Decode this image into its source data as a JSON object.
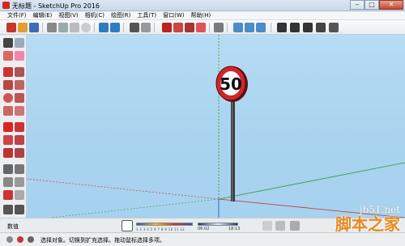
{
  "window": {
    "title": "无标题 - SketchUp Pro 2016",
    "minimize_icon": "minimize-icon",
    "maximize_icon": "maximize-icon",
    "close_icon": "close-icon"
  },
  "menu": [
    "文件(F)",
    "编辑(E)",
    "视图(V)",
    "相机(C)",
    "绘图(R)",
    "工具(T)",
    "窗口(W)",
    "帮助(H)"
  ],
  "toolbar": {
    "icons": [
      "new-icon",
      "open-icon",
      "save-icon",
      "cut-icon",
      "copy-icon",
      "paste-icon",
      "erase-icon",
      "undo-icon",
      "redo-icon",
      "print-icon",
      "model-info-icon",
      "component-icon",
      "group-icon",
      "upload-icon",
      "download-icon",
      "share-icon",
      "views-iso-icon",
      "views-top-icon",
      "views-front-icon",
      "views-right-icon",
      "views-back-icon",
      "views-left-icon"
    ]
  },
  "left_tools": [
    "select-icon",
    "make-component-icon",
    "paint-bucket-icon",
    "eraser-icon",
    "pencil-icon",
    "freehand-icon",
    "rectangle-icon",
    "rotated-rectangle-icon",
    "circle-icon",
    "polygon-icon",
    "arc-icon",
    "pie-icon",
    "move-icon",
    "push-pull-icon",
    "rotate-icon",
    "follow-me-icon",
    "scale-icon",
    "offset-icon",
    "tape-measure-icon",
    "dimension-icon",
    "protractor-icon",
    "text-icon",
    "axes-icon",
    "3d-text-icon",
    "orbit-icon",
    "pan-icon",
    "zoom-icon",
    "zoom-extents-icon"
  ],
  "scene": {
    "sign_text": "50",
    "sky_color": "#b0d8f2",
    "sign_ring_color": "#d2252b"
  },
  "bottom": {
    "measurements_label": "数值",
    "month_ticks": "1 2 3 4 5 6 7 8 9 10 11 12",
    "time_start": "06:02",
    "time_end": "18:13"
  },
  "status": {
    "text": "选择对象。切换到扩充选择。拖动鼠标选择多项。"
  },
  "watermark": {
    "line1": "jb51.net",
    "line2": "脚本之家"
  },
  "colors": {
    "accent_red": "#d8251d",
    "toolbar_bg": "#eceef0"
  }
}
